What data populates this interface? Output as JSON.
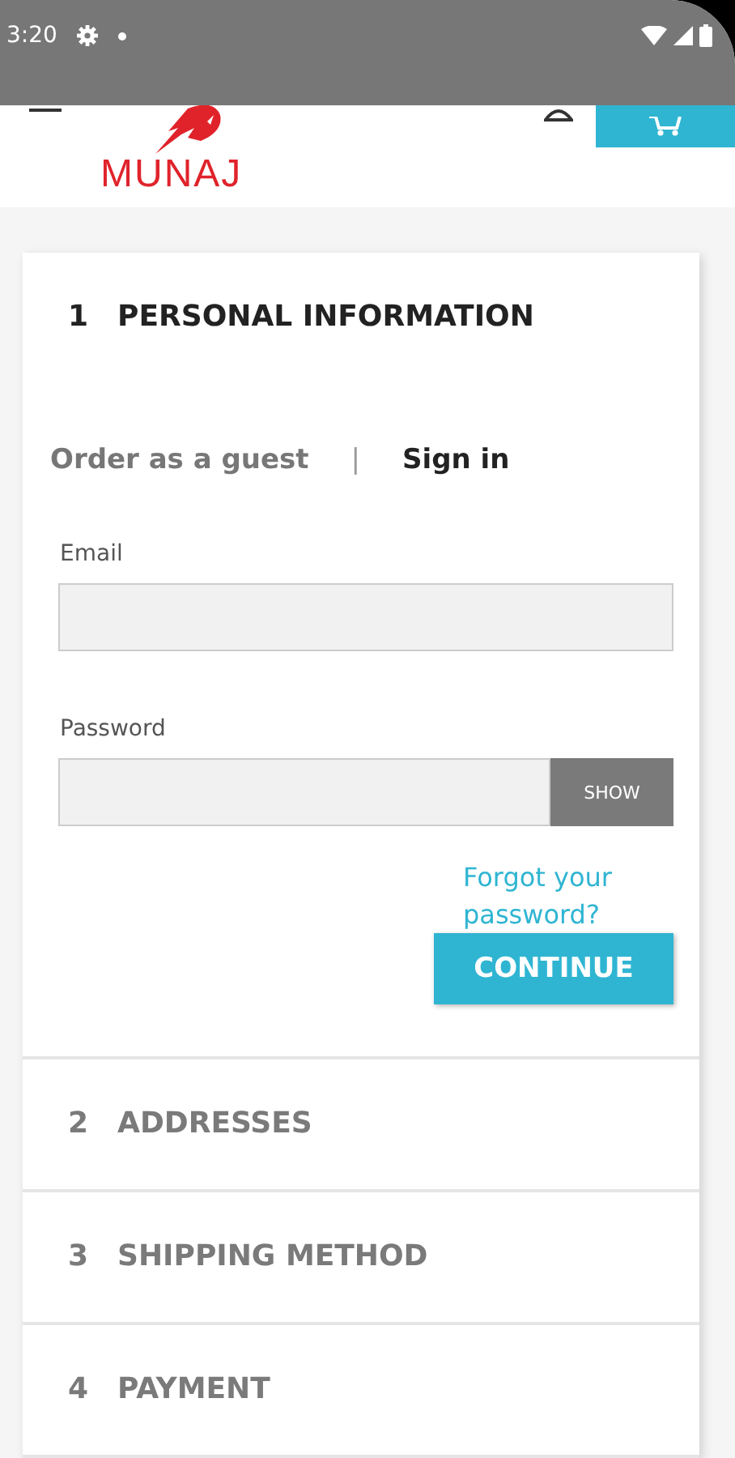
{
  "status_bar": {
    "time": "3:20"
  },
  "header": {
    "logo": "MUNAJ"
  },
  "steps": [
    {
      "number": "1",
      "title": "PERSONAL INFORMATION",
      "selected": true
    },
    {
      "number": "2",
      "title": "ADDRESSES",
      "selected": false
    },
    {
      "number": "3",
      "title": "SHIPPING METHOD",
      "selected": false
    },
    {
      "number": "4",
      "title": "PAYMENT",
      "selected": false
    }
  ],
  "tabs": [
    {
      "label": "Order as a guest",
      "selected": false
    },
    {
      "label": "Sign in",
      "selected": true
    }
  ],
  "tab_separator": "|",
  "fields": [
    {
      "label": "Email"
    },
    {
      "label": "Password",
      "toggle": "SHOW"
    }
  ],
  "forgot_link": "Forgot your password?",
  "continue_button": "CONTINUE"
}
